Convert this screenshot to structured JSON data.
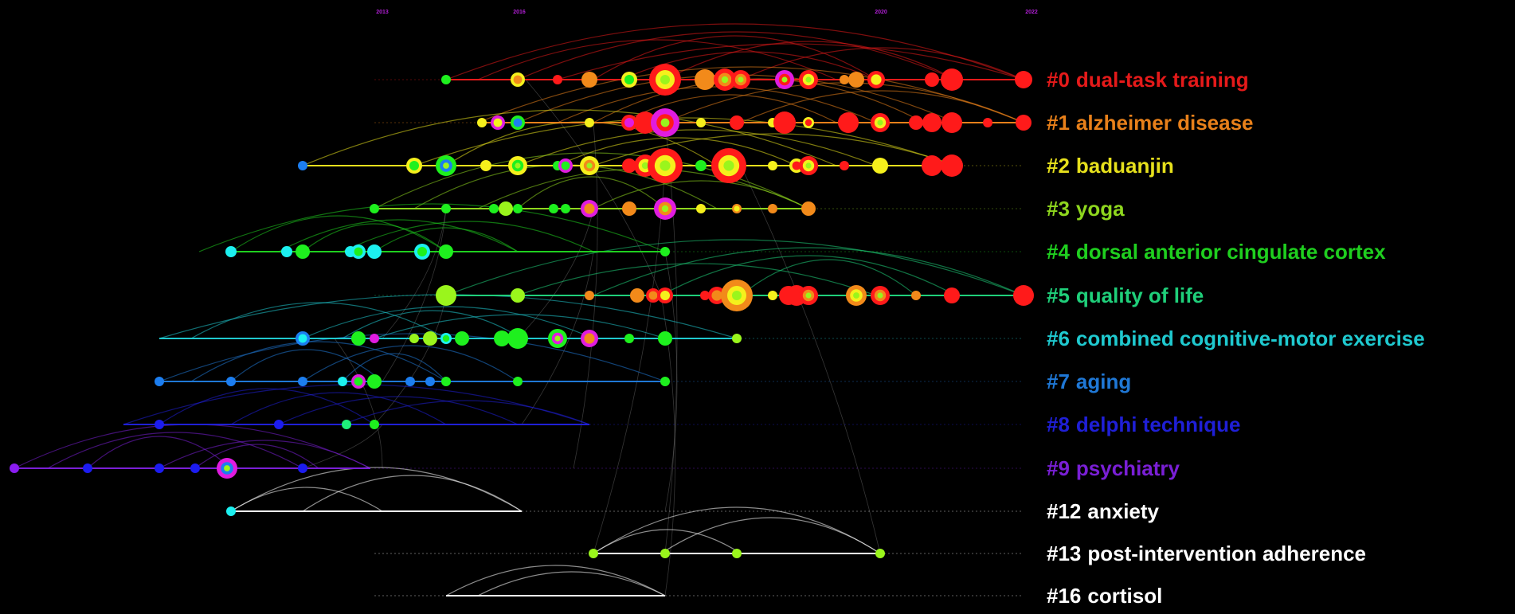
{
  "timeline": {
    "years": [
      "2013",
      "2016",
      "2020",
      "2022"
    ],
    "year_color": "#b21fd6",
    "clusters": [
      {
        "id": "#0",
        "label": "dual-task training",
        "color": "#e51a1a"
      },
      {
        "id": "#1",
        "label": "alzheimer disease",
        "color": "#e8801a"
      },
      {
        "id": "#2",
        "label": "baduanjin",
        "color": "#e6e01c"
      },
      {
        "id": "#3",
        "label": "yoga",
        "color": "#8ed61e"
      },
      {
        "id": "#4",
        "label": "dorsal anterior cingulate cortex",
        "color": "#1fcf1f"
      },
      {
        "id": "#5",
        "label": "quality of life",
        "color": "#1fcf7a"
      },
      {
        "id": "#6",
        "label": "combined cognitive-motor exercise",
        "color": "#1fc9cf"
      },
      {
        "id": "#7",
        "label": "aging",
        "color": "#1f78d6"
      },
      {
        "id": "#8",
        "label": "delphi technique",
        "color": "#1f1fd6"
      },
      {
        "id": "#9",
        "label": "psychiatry",
        "color": "#7a1fd6"
      },
      {
        "id": "#12",
        "label": "anxiety",
        "color": "#ffffff"
      },
      {
        "id": "#13",
        "label": "post-intervention adherence",
        "color": "#ffffff"
      },
      {
        "id": "#16",
        "label": "cortisol",
        "color": "#ffffff"
      }
    ],
    "node_colors": {
      "red": "#ff1a1a",
      "orange": "#f28a1a",
      "yellow": "#f5f01c",
      "lime": "#9af51c",
      "green": "#1ef01e",
      "mint": "#1ef07a",
      "cyan": "#1cf0f0",
      "blue": "#1c7ef0",
      "navy": "#1c1cf0",
      "purple": "#8a1cf0",
      "magenta": "#e01ce0"
    }
  }
}
